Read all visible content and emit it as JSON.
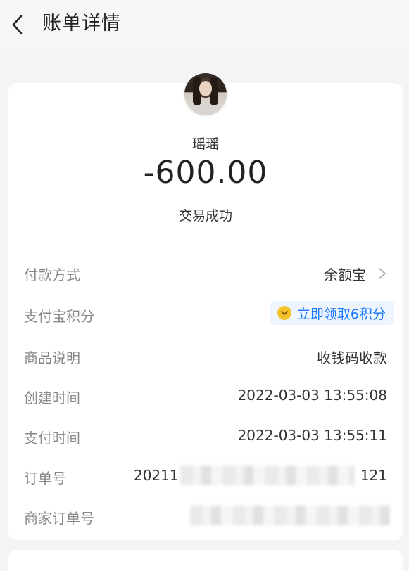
{
  "header": {
    "title": "账单详情"
  },
  "transaction": {
    "payee_name": "瑶瑶",
    "amount": "-600.00",
    "status": "交易成功"
  },
  "details": {
    "payment_method": {
      "label": "付款方式",
      "value": "余额宝"
    },
    "alipay_points": {
      "label": "支付宝积分",
      "action": "立即领取6积分"
    },
    "product_description": {
      "label": "商品说明",
      "value": "收钱码收款"
    },
    "created_time": {
      "label": "创建时间",
      "value": "2022-03-03 13:55:08"
    },
    "payment_time": {
      "label": "支付时间",
      "value": "2022-03-03 13:55:11"
    },
    "order_number": {
      "label": "订单号",
      "prefix": "20211",
      "suffix": "121"
    },
    "merchant_order_number": {
      "label": "商家订单号"
    }
  },
  "colors": {
    "accent": "#1677ff",
    "points_pill_bg": "#eef5ff",
    "coin": "#f4c22b"
  }
}
